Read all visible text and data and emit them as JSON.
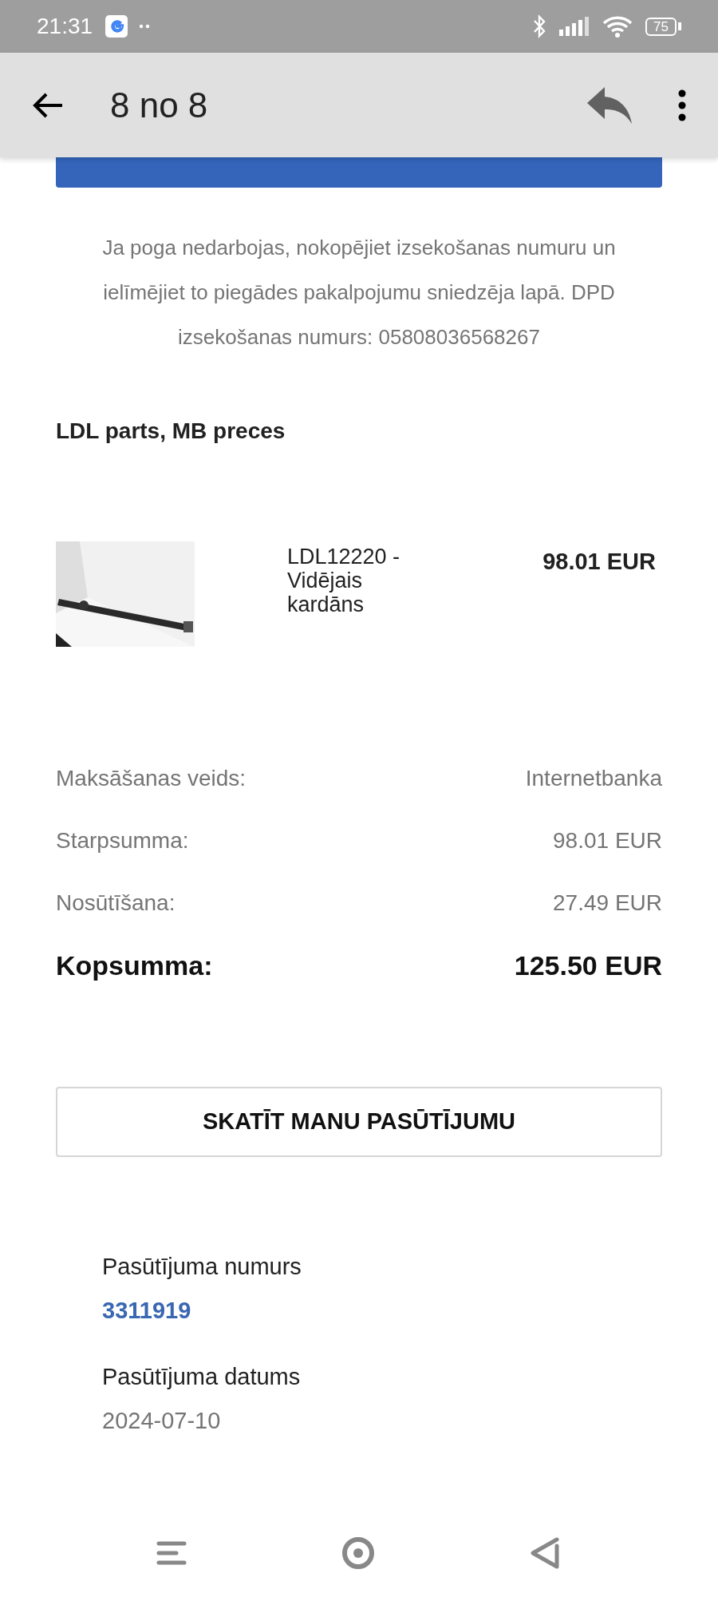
{
  "status_bar": {
    "time": "21:31",
    "battery": "75"
  },
  "app_bar": {
    "title": "8 no 8"
  },
  "tracking_note": "Ja poga nedarbojas, nokopējiet izsekošanas numuru un ielīmējiet to piegādes pakalpojumu sniedzēja lapā. DPD izsekošanas numurs: 05808036568267",
  "shop_name": "LDL parts, MB preces",
  "items": [
    {
      "name": "LDL12220 - Vidējais kardāns",
      "price": "98.01 EUR"
    }
  ],
  "summary": [
    {
      "label": "Maksāšanas veids:",
      "value": "Internetbanka",
      "kind": "plain"
    },
    {
      "label": "Starpsumma:",
      "value": "98.01 EUR",
      "kind": "plain"
    },
    {
      "label": "Nosūtīšana:",
      "value": "27.49 EUR",
      "kind": "plain"
    },
    {
      "label": "Kopsumma:",
      "value": "125.50 EUR",
      "kind": "total"
    }
  ],
  "view_order_button": "SKATĪT MANU PASŪTĪJUMU",
  "order_info": [
    {
      "label": "Pasūtījuma numurs",
      "value": "3311919",
      "kind": "link"
    },
    {
      "label": "Pasūtījuma datums",
      "value": "2024-07-10",
      "kind": "plain"
    }
  ]
}
